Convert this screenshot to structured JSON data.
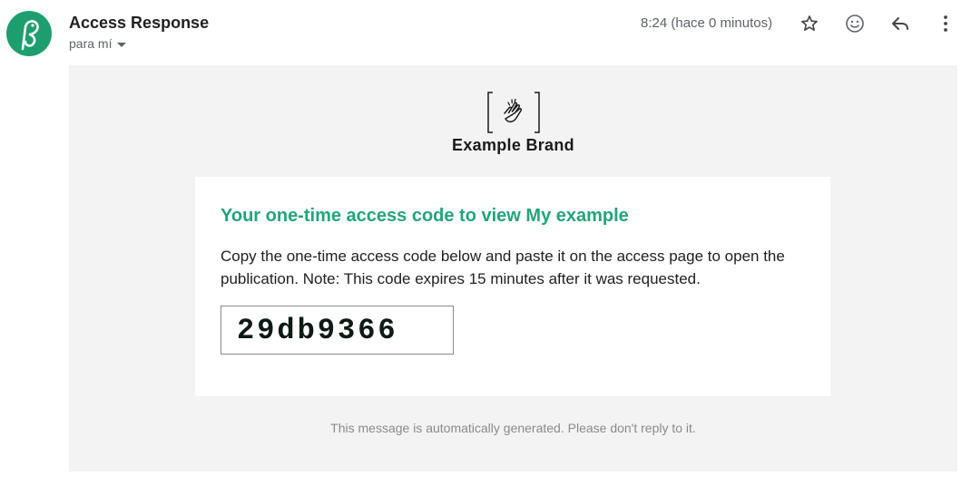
{
  "email": {
    "subject": "Access Response",
    "recipient": "para mí",
    "timestamp": "8:24 (hace 0 minutos)"
  },
  "header_icons": [
    "star-icon",
    "emoji-icon",
    "reply-icon",
    "more-icon"
  ],
  "colors": {
    "avatar_bg": "#1d9e6e",
    "accent": "#23a57a",
    "body_bg": "#f3f3f3"
  },
  "brand": {
    "name": "Example Brand"
  },
  "card": {
    "title": "Your one-time access code to view My example",
    "text": "Copy the one-time access code below and paste it on the access page to open the publication. Note: This code expires 15 minutes after it was requested.",
    "code": "29db9366"
  },
  "footer": {
    "note": "This message is automatically generated. Please don't reply to it."
  }
}
